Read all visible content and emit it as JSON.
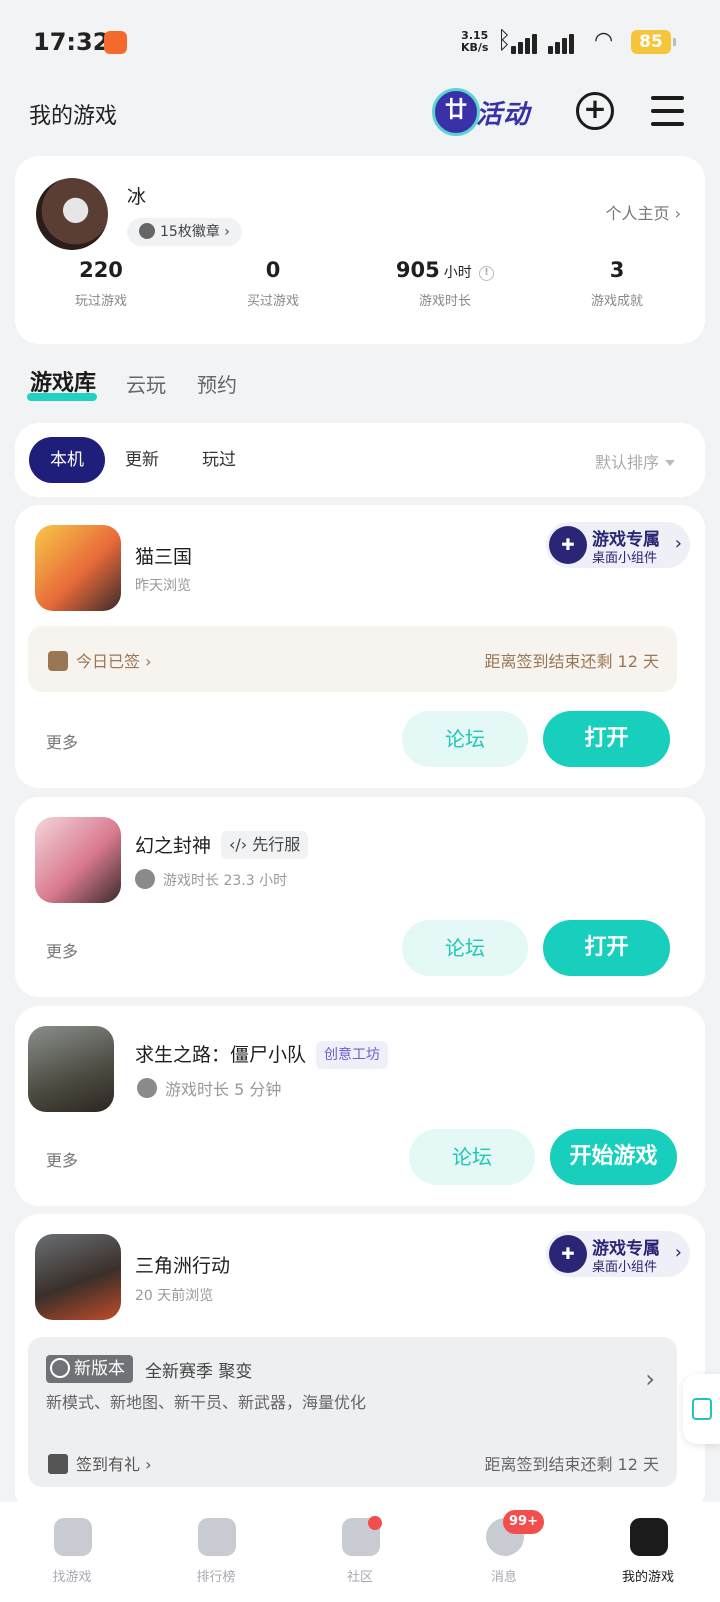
{
  "status": {
    "time": "17:32",
    "net_speed": "3.15",
    "net_unit": "KB/s",
    "battery": "85"
  },
  "header": {
    "title": "我的游戏",
    "activity_label": "活动"
  },
  "profile": {
    "username": "冰",
    "badges": "15枚徽章",
    "homepage": "个人主页",
    "stats": [
      {
        "value": "220",
        "unit": "",
        "label": "玩过游戏"
      },
      {
        "value": "0",
        "unit": "",
        "label": "买过游戏"
      },
      {
        "value": "905",
        "unit": "小时",
        "label": "游戏时长"
      },
      {
        "value": "3",
        "unit": "",
        "label": "游戏成就"
      }
    ]
  },
  "tabs": [
    "游戏库",
    "云玩",
    "预约"
  ],
  "filter": {
    "chips": [
      "本机",
      "更新",
      "玩过"
    ],
    "sort": "默认排序"
  },
  "games": [
    {
      "name": "猫三国",
      "sub": "昨天浏览",
      "widget_l1": "游戏专属",
      "widget_l2": "桌面小组件",
      "sign_left": "今日已签",
      "sign_right": "距离签到结束还剩 12 天",
      "more": "更多",
      "forum": "论坛",
      "open": "打开"
    },
    {
      "name": "幻之封神",
      "tag": "先行服",
      "sub": "游戏时长 23.3 小时",
      "more": "更多",
      "forum": "论坛",
      "open": "打开"
    },
    {
      "name": "求生之路：僵尸小队",
      "tag": "创意工坊",
      "sub": "游戏时长 5 分钟",
      "more": "更多",
      "forum": "论坛",
      "open": "开始游戏"
    },
    {
      "name": "三角洲行动",
      "sub": "20 天前浏览",
      "widget_l1": "游戏专属",
      "widget_l2": "桌面小组件",
      "news_tag": "新版本",
      "news_head": "全新赛季 聚变",
      "news_desc": "新模式、新地图、新干员、新武器，海量优化",
      "gift": "签到有礼",
      "gift_right": "距离签到结束还剩 12 天"
    }
  ],
  "bottom_nav": [
    {
      "label": "找游戏"
    },
    {
      "label": "排行榜"
    },
    {
      "label": "社区"
    },
    {
      "label": "消息",
      "badge": "99+"
    },
    {
      "label": "我的游戏"
    }
  ],
  "colors": {
    "accent": "#18cfbe",
    "primary_dark": "#1f1e7a",
    "badge_red": "#f24e4e"
  }
}
